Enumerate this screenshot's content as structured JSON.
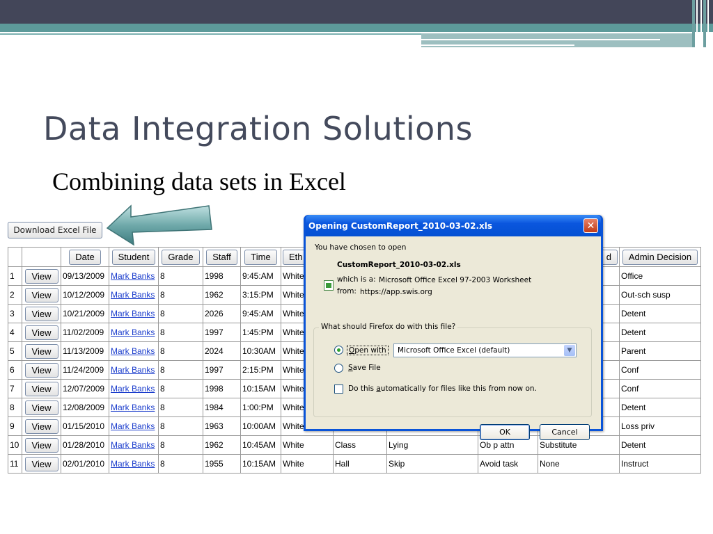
{
  "slide": {
    "title": "Data Integration Solutions",
    "subtitle": "Combining data sets in Excel"
  },
  "download_button": "Download Excel File",
  "table": {
    "headers": [
      "",
      "",
      "Date",
      "Student",
      "Grade",
      "Staff",
      "Time",
      "Eth",
      "",
      "",
      "",
      "d",
      "Admin Decision"
    ],
    "view_label": "View",
    "rows": [
      {
        "n": "1",
        "date": "09/13/2009",
        "student": "Mark Banks",
        "grade": "8",
        "staff": "1998",
        "time": "9:45:AM",
        "eth": "White",
        "loc": "",
        "prob": "",
        "motiv": "",
        "others": "",
        "decision": "Office"
      },
      {
        "n": "2",
        "date": "10/12/2009",
        "student": "Mark Banks",
        "grade": "8",
        "staff": "1962",
        "time": "3:15:PM",
        "eth": "White",
        "loc": "",
        "prob": "",
        "motiv": "",
        "others": "",
        "decision": "Out-sch susp"
      },
      {
        "n": "3",
        "date": "10/21/2009",
        "student": "Mark Banks",
        "grade": "8",
        "staff": "2026",
        "time": "9:45:AM",
        "eth": "White",
        "loc": "",
        "prob": "",
        "motiv": "",
        "others": "",
        "decision": "Detent"
      },
      {
        "n": "4",
        "date": "11/02/2009",
        "student": "Mark Banks",
        "grade": "8",
        "staff": "1997",
        "time": "1:45:PM",
        "eth": "White",
        "loc": "",
        "prob": "",
        "motiv": "",
        "others": "",
        "decision": "Detent"
      },
      {
        "n": "5",
        "date": "11/13/2009",
        "student": "Mark Banks",
        "grade": "8",
        "staff": "2024",
        "time": "10:30AM",
        "eth": "White",
        "loc": "",
        "prob": "",
        "motiv": "",
        "others": "",
        "decision": "Parent"
      },
      {
        "n": "6",
        "date": "11/24/2009",
        "student": "Mark Banks",
        "grade": "8",
        "staff": "1997",
        "time": "2:15:PM",
        "eth": "White",
        "loc": "",
        "prob": "",
        "motiv": "",
        "others": "",
        "decision": "Conf"
      },
      {
        "n": "7",
        "date": "12/07/2009",
        "student": "Mark Banks",
        "grade": "8",
        "staff": "1998",
        "time": "10:15AM",
        "eth": "White",
        "loc": "",
        "prob": "",
        "motiv": "",
        "others": "",
        "decision": "Conf"
      },
      {
        "n": "8",
        "date": "12/08/2009",
        "student": "Mark Banks",
        "grade": "8",
        "staff": "1984",
        "time": "1:00:PM",
        "eth": "White",
        "loc": "",
        "prob": "",
        "motiv": "",
        "others": "",
        "decision": "Detent"
      },
      {
        "n": "9",
        "date": "01/15/2010",
        "student": "Mark Banks",
        "grade": "8",
        "staff": "1963",
        "time": "10:00AM",
        "eth": "White",
        "loc": "",
        "prob": "",
        "motiv": "",
        "others": "",
        "decision": "Loss priv"
      },
      {
        "n": "10",
        "date": "01/28/2010",
        "student": "Mark Banks",
        "grade": "8",
        "staff": "1962",
        "time": "10:45AM",
        "eth": "White",
        "loc": "Class",
        "prob": "Lying",
        "motiv": "Ob p attn",
        "others": "Substitute",
        "decision": "Detent"
      },
      {
        "n": "11",
        "date": "02/01/2010",
        "student": "Mark Banks",
        "grade": "8",
        "staff": "1955",
        "time": "10:15AM",
        "eth": "White",
        "loc": "Hall",
        "prob": "Skip",
        "motiv": "Avoid task",
        "others": "None",
        "decision": "Instruct"
      }
    ]
  },
  "dialog": {
    "title": "Opening CustomReport_2010-03-02.xls",
    "chosen_text": "You have chosen to open",
    "filename": "CustomReport_2010-03-02.xls",
    "which_is_label": "which is a:",
    "which_is_value": "Microsoft Office Excel 97-2003 Worksheet",
    "from_label": "from:",
    "from_value": "https://app.swis.org",
    "question": "What should Firefox do with this file?",
    "open_with_label": "Open with",
    "open_with_value": "Microsoft Office Excel (default)",
    "save_file_label": "Save File",
    "auto_label": "Do this automatically for files like this from now on.",
    "ok_label": "OK",
    "cancel_label": "Cancel",
    "open_with_selected": true,
    "auto_checked": false
  },
  "colors": {
    "top_bar": "#434659",
    "accent_teal": "#5d9a9a",
    "title_text": "#444a5c",
    "dialog_blue": "#0a54d8",
    "dialog_face": "#ece9d8",
    "link": "#1a3ccc"
  },
  "icons": [
    "arrow-left-icon",
    "close-icon",
    "excel-file-icon",
    "chevron-down-icon"
  ]
}
